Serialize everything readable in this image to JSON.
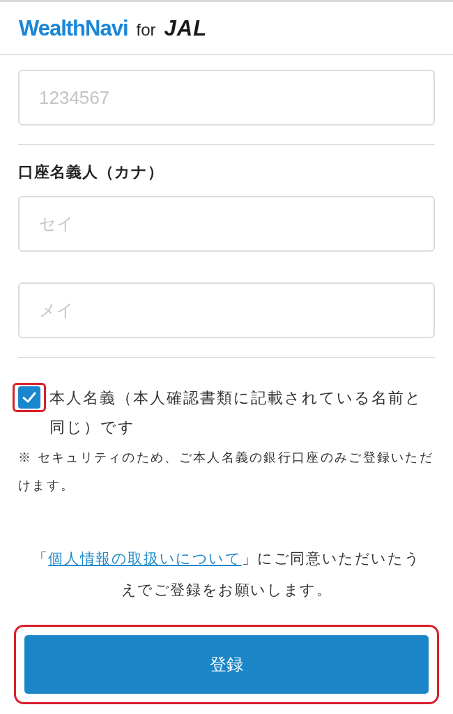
{
  "header": {
    "brand": "WealthNavi",
    "for": "for",
    "partner": "JAL"
  },
  "account_number": {
    "placeholder": "1234567"
  },
  "holder_kana": {
    "label": "口座名義人（カナ）",
    "fields": [
      {
        "placeholder": "セイ"
      },
      {
        "placeholder": "メイ"
      }
    ]
  },
  "same_name": {
    "checked": true,
    "label": "本人名義（本人確認書類に記載されている名前と同じ）です",
    "highlighted": true
  },
  "note": "※ セキュリティのため、ご本人名義の銀行口座のみご登録いただけます。",
  "consent": {
    "before": "「",
    "link": "個人情報の取扱いについて",
    "after": "」にご同意いただいたうえでご登録をお願いします。"
  },
  "submit": {
    "label": "登録",
    "highlighted": true
  }
}
